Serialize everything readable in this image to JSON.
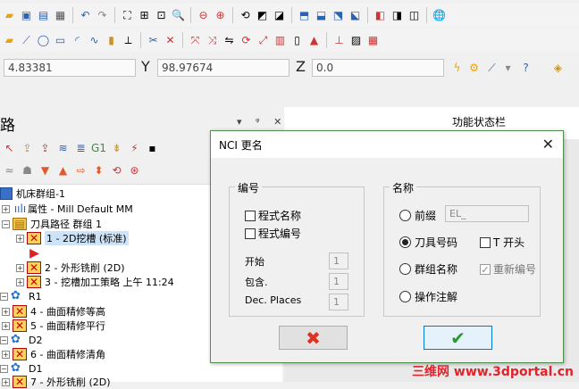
{
  "toolbar_icons_row1": [
    "folder-icon",
    "save-icon",
    "save-as-icon",
    "print-icon",
    "undo-icon",
    "redo-icon",
    "zoom-fit-icon",
    "zoom-window-icon",
    "zoom-target-icon",
    "zoom-prev-icon",
    "zoom-out-icon",
    "zoom-in-icon",
    "view-rotate-icon",
    "view-iso-icon",
    "view-plane-icon",
    "cube-top-icon",
    "cube-front-icon",
    "cube-right-icon",
    "cube-iso-icon",
    "cube-shade-icon",
    "cube-wire-icon",
    "globe-icon"
  ],
  "toolbar_icons_row2": [
    "folder-open-icon",
    "line-icon",
    "circle-icon",
    "rectangle-icon",
    "arc-icon",
    "spline-icon",
    "cylinder-icon",
    "ruler-icon",
    "trim-icon",
    "delete-icon",
    "snap-icon",
    "transform-icon",
    "mirror-icon",
    "rotate-icon",
    "scale-icon",
    "array-icon",
    "offset-icon",
    "solid-icon",
    "surface-icon",
    "mesh-icon",
    "grid-icon"
  ],
  "coordinates": {
    "x_value": "4.83381",
    "y_label": "Y",
    "y_value": "98.97674",
    "z_label": "Z",
    "z_value": "0.0"
  },
  "left_panel": {
    "title": "路",
    "controls": "▾ ᵠ ✕"
  },
  "right_panel": {
    "title": "功能状态栏"
  },
  "tree": [
    {
      "label": "机床群组-1",
      "indent": 0,
      "kind": "machine"
    },
    {
      "label": "属性 - Mill Default MM",
      "indent": 1,
      "kind": "props"
    },
    {
      "label": "刀具路径 群组 1",
      "indent": 1,
      "kind": "group"
    },
    {
      "label": "1 - 2D挖槽 (标准)",
      "indent": 2,
      "kind": "op",
      "selected": true
    },
    {
      "label": "",
      "indent": 2,
      "kind": "arrow"
    },
    {
      "label": "2 - 外形铣削 (2D)",
      "indent": 2,
      "kind": "op"
    },
    {
      "label": "3 - 挖槽加工策略 上午 11:24",
      "indent": 2,
      "kind": "op"
    },
    {
      "label": "R1",
      "indent": 0,
      "kind": "group2"
    },
    {
      "label": "4 - 曲面精修等高",
      "indent": 1,
      "kind": "op"
    },
    {
      "label": "5 - 曲面精修平行",
      "indent": 1,
      "kind": "op"
    },
    {
      "label": "D2",
      "indent": 0,
      "kind": "group2"
    },
    {
      "label": "6 - 曲面精修清角",
      "indent": 1,
      "kind": "op"
    },
    {
      "label": "D1",
      "indent": 0,
      "kind": "group2"
    },
    {
      "label": "7 - 外形铣削 (2D)",
      "indent": 1,
      "kind": "op"
    }
  ],
  "dialog": {
    "title": "NCI 更名",
    "numbering": {
      "label": "编号",
      "program_name": "程式名称",
      "program_number": "程式编号",
      "start_label": "开始",
      "start_value": "1",
      "include_label": "包含.",
      "include_value": "1",
      "places_label": "Dec. Places",
      "places_value": "1"
    },
    "naming": {
      "label": "名称",
      "prefix": "前缀",
      "prefix_value": "EL_",
      "tool_number": "刀具号码",
      "t_start": "T 开头",
      "group_name": "群组名称",
      "renumber": "重新编号",
      "op_comment": "操作注解"
    },
    "cancel_glyph": "✖",
    "ok_glyph": "✔"
  },
  "watermark": "三维网 www.3dportal.cn"
}
